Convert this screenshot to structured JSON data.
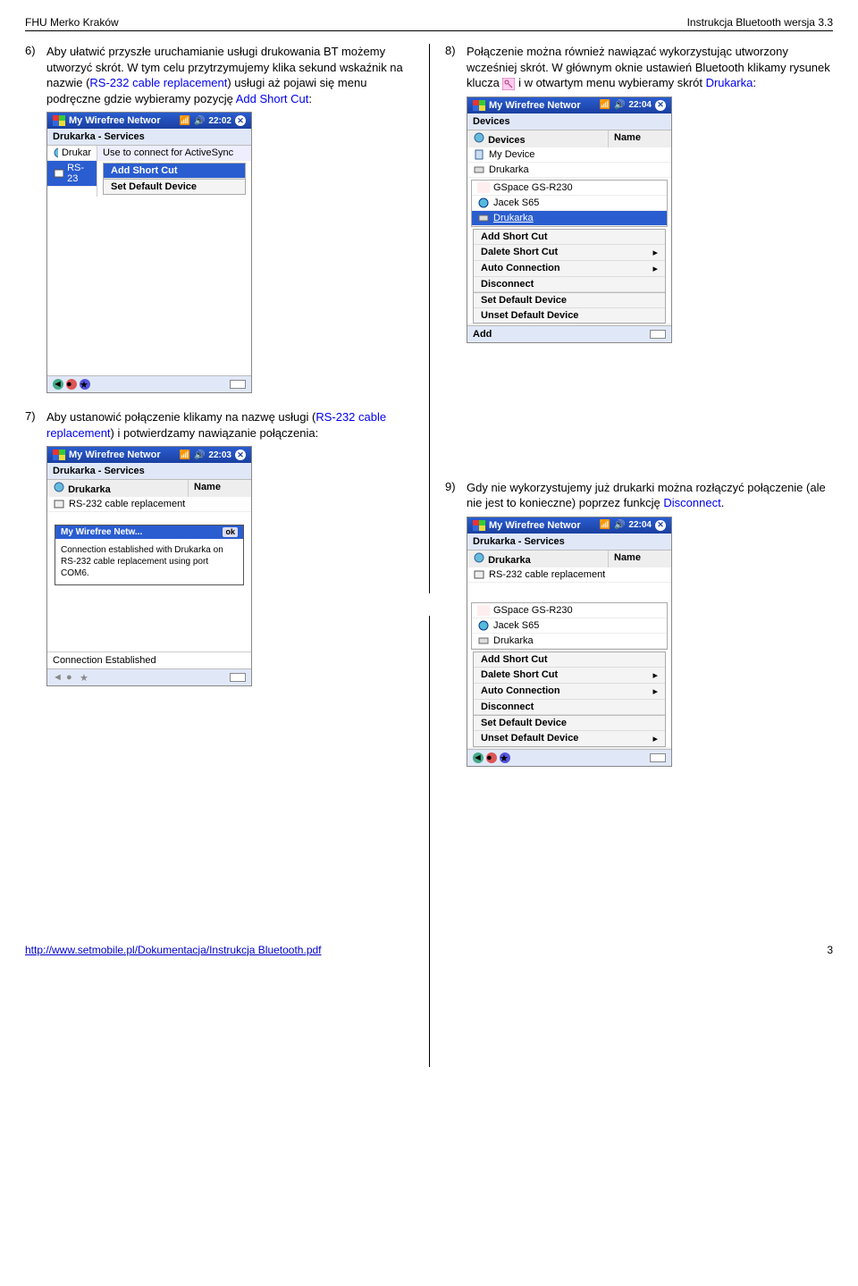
{
  "header": {
    "left": "FHU Merko  Kraków",
    "right": "Instrukcja Bluetooth wersja 3.3"
  },
  "steps": {
    "s6": {
      "num": "6)",
      "t1": "Aby ułatwić przyszłe uruchamianie usługi drukowania BT możemy utworzyć skrót. W tym celu przytrzymujemy klika sekund wskaźnik na nazwie (",
      "b1": "RS-232 cable replacement",
      "t2": ") usługi aż pojawi się menu podręczne gdzie wybieramy pozycję ",
      "b2": "Add Short Cut",
      "t3": ":"
    },
    "s7": {
      "num": "7)",
      "t1": "Aby ustanowić połączenie klikamy na nazwę usługi (",
      "b1": "RS-232 cable replacement",
      "t2": ") i potwierdzamy nawiązanie połączenia:"
    },
    "s8": {
      "num": "8)",
      "t1": "Połączenie można również nawiązać wykorzystując utworzony wcześniej skrót. W głównym oknie ustawień Bluetooth klikamy rysunek klucza ",
      "t2": " i w otwartym menu wybieramy skrót ",
      "b1": "Drukarka",
      "t3": ":"
    },
    "s9": {
      "num": "9)",
      "t1": "Gdy nie wykorzystujemy już drukarki można rozłączyć połączenie (ale nie jest to konieczne) poprzez funkcję ",
      "b1": "Disconnect",
      "t2": "."
    }
  },
  "shot6": {
    "title": "My Wirefree Networ",
    "time": "22:02",
    "sub": "Drukarka - Services",
    "line_use": "Use to connect for ActiveSync",
    "left1": "Drukar",
    "left2": "RS-23",
    "m1": "Add Short Cut",
    "m2": "Set Default Device"
  },
  "shot7": {
    "title": "My Wirefree Networ",
    "time": "22:03",
    "sub": "Drukarka - Services",
    "col1": "Drukarka",
    "col2": "Name",
    "item": "RS-232 cable replacement",
    "popup_title": "My Wirefree Netw...",
    "popup_ok": "ok",
    "popup_body": "Connection established with Drukarka on RS-232 cable replacement using port COM6.",
    "status": "Connection Established"
  },
  "shot8": {
    "title": "My Wirefree Networ",
    "time": "22:04",
    "sub": "Devices",
    "col1": "Devices",
    "col2": "Name",
    "d1": "My Device",
    "d2": "Drukarka",
    "d3": "GSpace GS-R230",
    "d4": "Jacek S65",
    "d5": "Drukarka",
    "m1": "Add Short Cut",
    "m2": "Dalete Short Cut",
    "m3": "Auto Connection",
    "m4": "Disconnect",
    "m5": "Set Default Device",
    "m6": "Unset Default Device",
    "foot": "Add"
  },
  "shot9": {
    "title": "My Wirefree Networ",
    "time": "22:04",
    "sub": "Drukarka - Services",
    "col1": "Drukarka",
    "col2": "Name",
    "item": "RS-232 cable replacement",
    "d3": "GSpace GS-R230",
    "d4": "Jacek S65",
    "d5": "Drukarka",
    "m1": "Add Short Cut",
    "m2": "Dalete Short Cut",
    "m3": "Auto Connection",
    "m4": "Disconnect",
    "m5": "Set Default Device",
    "m6": "Unset Default Device"
  },
  "footer": {
    "url": "http://www.setmobile.pl/Dokumentacja/Instrukcja Bluetooth.pdf",
    "page": "3"
  }
}
